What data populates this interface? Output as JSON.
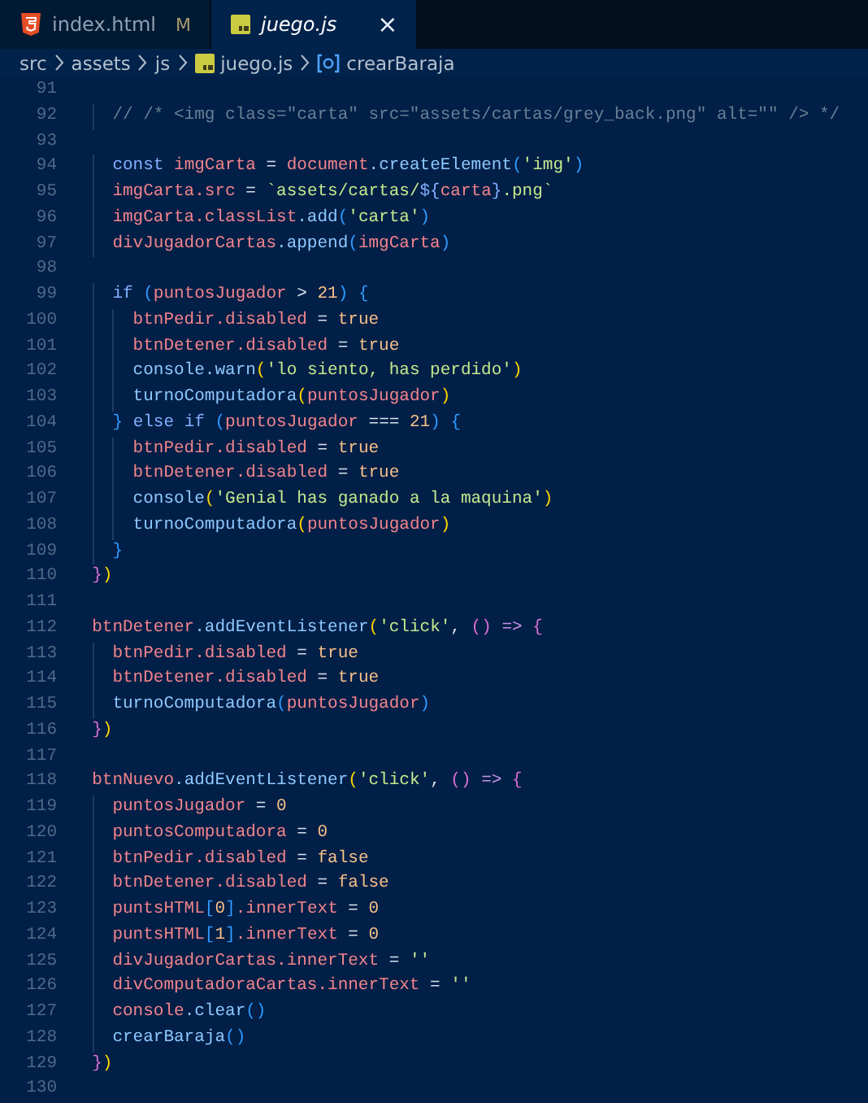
{
  "tabs": [
    {
      "kind": "html",
      "label": "index.html",
      "status": "M",
      "selected": false,
      "preview": false
    },
    {
      "kind": "js",
      "label": "juego.js",
      "close": "×",
      "selected": true,
      "preview": true
    }
  ],
  "breadcrumb": [
    {
      "kind": "folder",
      "label": "src"
    },
    {
      "kind": "folder",
      "label": "assets"
    },
    {
      "kind": "folder",
      "label": "js"
    },
    {
      "kind": "js",
      "label": "juego.js"
    },
    {
      "kind": "symbol",
      "label": "crearBaraja"
    }
  ],
  "lines": [
    {
      "number": "91"
    },
    {
      "number": "92",
      "tokens": [
        {
          "kind": "comment",
          "text": "    // /* <img class=\"carta\" src=\"assets/cartas/grey_back.png\" alt=\"\" /> */"
        }
      ]
    },
    {
      "number": "93"
    },
    {
      "number": "94",
      "tokens": [
        {
          "kind": "keyword",
          "text": "    const "
        },
        {
          "kind": "variable",
          "text": "imgCarta"
        },
        {
          "kind": "plain",
          "text": " = "
        },
        {
          "kind": "variable",
          "text": "document"
        },
        {
          "kind": "function",
          "text": ".createElement"
        },
        {
          "kind": "bracket3",
          "text": "("
        },
        {
          "kind": "string",
          "text": "'img'"
        },
        {
          "kind": "bracket3",
          "text": ")"
        }
      ]
    },
    {
      "number": "95",
      "tokens": [
        {
          "kind": "variable",
          "text": "    imgCarta.src"
        },
        {
          "kind": "plain",
          "text": " = "
        },
        {
          "kind": "string",
          "text": "`assets/cartas/"
        },
        {
          "kind": "keyword",
          "text": "${"
        },
        {
          "kind": "variable",
          "text": "carta"
        },
        {
          "kind": "keyword",
          "text": "}"
        },
        {
          "kind": "string",
          "text": ".png`"
        }
      ]
    },
    {
      "number": "96",
      "tokens": [
        {
          "kind": "variable",
          "text": "    imgCarta.classList"
        },
        {
          "kind": "function",
          "text": ".add"
        },
        {
          "kind": "bracket3",
          "text": "("
        },
        {
          "kind": "string",
          "text": "'carta'"
        },
        {
          "kind": "bracket3",
          "text": ")"
        }
      ]
    },
    {
      "number": "97",
      "tokens": [
        {
          "kind": "variable",
          "text": "    divJugadorCartas"
        },
        {
          "kind": "function",
          "text": ".append"
        },
        {
          "kind": "bracket3",
          "text": "("
        },
        {
          "kind": "variable",
          "text": "imgCarta"
        },
        {
          "kind": "bracket3",
          "text": ")"
        }
      ]
    },
    {
      "number": "98"
    },
    {
      "number": "99",
      "tokens": [
        {
          "kind": "keyword",
          "text": "    if "
        },
        {
          "kind": "bracket3",
          "text": "("
        },
        {
          "kind": "variable",
          "text": "puntosJugador"
        },
        {
          "kind": "plain",
          "text": " > "
        },
        {
          "kind": "number",
          "text": "21"
        },
        {
          "kind": "bracket3",
          "text": ") {"
        }
      ]
    },
    {
      "number": "100",
      "tokens": [
        {
          "kind": "variable",
          "text": "      btnPedir.disabled"
        },
        {
          "kind": "plain",
          "text": " = "
        },
        {
          "kind": "boolean",
          "text": "true"
        }
      ]
    },
    {
      "number": "101",
      "tokens": [
        {
          "kind": "variable",
          "text": "      btnDetener.disabled"
        },
        {
          "kind": "plain",
          "text": " = "
        },
        {
          "kind": "boolean",
          "text": "true"
        }
      ]
    },
    {
      "number": "102",
      "tokens": [
        {
          "kind": "function",
          "text": "      console.warn"
        },
        {
          "kind": "bracket1",
          "text": "("
        },
        {
          "kind": "string",
          "text": "'lo siento, has perdido'"
        },
        {
          "kind": "bracket1",
          "text": ")"
        }
      ]
    },
    {
      "number": "103",
      "tokens": [
        {
          "kind": "function",
          "text": "      turnoComputadora"
        },
        {
          "kind": "bracket1",
          "text": "("
        },
        {
          "kind": "variable",
          "text": "puntosJugador"
        },
        {
          "kind": "bracket1",
          "text": ")"
        }
      ]
    },
    {
      "number": "104",
      "tokens": [
        {
          "kind": "bracket3",
          "text": "    }"
        },
        {
          "kind": "keyword",
          "text": " else if "
        },
        {
          "kind": "bracket3",
          "text": "("
        },
        {
          "kind": "variable",
          "text": "puntosJugador"
        },
        {
          "kind": "plain",
          "text": " === "
        },
        {
          "kind": "number",
          "text": "21"
        },
        {
          "kind": "bracket3",
          "text": ") {"
        }
      ]
    },
    {
      "number": "105",
      "tokens": [
        {
          "kind": "variable",
          "text": "      btnPedir.disabled"
        },
        {
          "kind": "plain",
          "text": " = "
        },
        {
          "kind": "boolean",
          "text": "true"
        }
      ]
    },
    {
      "number": "106",
      "tokens": [
        {
          "kind": "variable",
          "text": "      btnDetener.disabled"
        },
        {
          "kind": "plain",
          "text": " = "
        },
        {
          "kind": "boolean",
          "text": "true"
        }
      ]
    },
    {
      "number": "107",
      "tokens": [
        {
          "kind": "function",
          "text": "      console"
        },
        {
          "kind": "bracket1",
          "text": "("
        },
        {
          "kind": "string",
          "text": "'Genial has ganado a la maquina'"
        },
        {
          "kind": "bracket1",
          "text": ")"
        }
      ]
    },
    {
      "number": "108",
      "tokens": [
        {
          "kind": "function",
          "text": "      turnoComputadora"
        },
        {
          "kind": "bracket1",
          "text": "("
        },
        {
          "kind": "variable",
          "text": "puntosJugador"
        },
        {
          "kind": "bracket1",
          "text": ")"
        }
      ]
    },
    {
      "number": "109",
      "tokens": [
        {
          "kind": "bracket3",
          "text": "    }"
        }
      ]
    },
    {
      "number": "110",
      "tokens": [
        {
          "kind": "bracket2",
          "text": "  }"
        },
        {
          "kind": "bracket1",
          "text": ")"
        }
      ]
    },
    {
      "number": "111"
    },
    {
      "number": "112",
      "tokens": [
        {
          "kind": "variable",
          "text": "  btnDetener"
        },
        {
          "kind": "function",
          "text": ".addEventListener"
        },
        {
          "kind": "bracket1",
          "text": "("
        },
        {
          "kind": "string",
          "text": "'click'"
        },
        {
          "kind": "plain",
          "text": ", "
        },
        {
          "kind": "bracket2",
          "text": "()"
        },
        {
          "kind": "arrow",
          "text": " => "
        },
        {
          "kind": "bracket2",
          "text": "{"
        }
      ]
    },
    {
      "number": "113",
      "tokens": [
        {
          "kind": "variable",
          "text": "    btnPedir.disabled"
        },
        {
          "kind": "plain",
          "text": " = "
        },
        {
          "kind": "boolean",
          "text": "true"
        }
      ]
    },
    {
      "number": "114",
      "tokens": [
        {
          "kind": "variable",
          "text": "    btnDetener.disabled"
        },
        {
          "kind": "plain",
          "text": " = "
        },
        {
          "kind": "boolean",
          "text": "true"
        }
      ]
    },
    {
      "number": "115",
      "tokens": [
        {
          "kind": "function",
          "text": "    turnoComputadora"
        },
        {
          "kind": "bracket3",
          "text": "("
        },
        {
          "kind": "variable",
          "text": "puntosJugador"
        },
        {
          "kind": "bracket3",
          "text": ")"
        }
      ]
    },
    {
      "number": "116",
      "tokens": [
        {
          "kind": "bracket2",
          "text": "  }"
        },
        {
          "kind": "bracket1",
          "text": ")"
        }
      ]
    },
    {
      "number": "117"
    },
    {
      "number": "118",
      "tokens": [
        {
          "kind": "variable",
          "text": "  btnNuevo"
        },
        {
          "kind": "function",
          "text": ".addEventListener"
        },
        {
          "kind": "bracket1",
          "text": "("
        },
        {
          "kind": "string",
          "text": "'click'"
        },
        {
          "kind": "plain",
          "text": ", "
        },
        {
          "kind": "bracket2",
          "text": "()"
        },
        {
          "kind": "arrow",
          "text": " => "
        },
        {
          "kind": "bracket2",
          "text": "{"
        }
      ]
    },
    {
      "number": "119",
      "tokens": [
        {
          "kind": "variable",
          "text": "    puntosJugador"
        },
        {
          "kind": "plain",
          "text": " = "
        },
        {
          "kind": "number",
          "text": "0"
        }
      ]
    },
    {
      "number": "120",
      "tokens": [
        {
          "kind": "variable",
          "text": "    puntosComputadora"
        },
        {
          "kind": "plain",
          "text": " = "
        },
        {
          "kind": "number",
          "text": "0"
        }
      ]
    },
    {
      "number": "121",
      "tokens": [
        {
          "kind": "variable",
          "text": "    btnPedir.disabled"
        },
        {
          "kind": "plain",
          "text": " = "
        },
        {
          "kind": "boolean",
          "text": "false"
        }
      ]
    },
    {
      "number": "122",
      "tokens": [
        {
          "kind": "variable",
          "text": "    btnDetener.disabled"
        },
        {
          "kind": "plain",
          "text": " = "
        },
        {
          "kind": "boolean",
          "text": "false"
        }
      ]
    },
    {
      "number": "123",
      "tokens": [
        {
          "kind": "variable",
          "text": "    puntsHTML"
        },
        {
          "kind": "bracket3",
          "text": "["
        },
        {
          "kind": "number",
          "text": "0"
        },
        {
          "kind": "bracket3",
          "text": "]"
        },
        {
          "kind": "variable",
          "text": ".innerText"
        },
        {
          "kind": "plain",
          "text": " = "
        },
        {
          "kind": "number",
          "text": "0"
        }
      ]
    },
    {
      "number": "124",
      "tokens": [
        {
          "kind": "variable",
          "text": "    puntsHTML"
        },
        {
          "kind": "bracket3",
          "text": "["
        },
        {
          "kind": "number",
          "text": "1"
        },
        {
          "kind": "bracket3",
          "text": "]"
        },
        {
          "kind": "variable",
          "text": ".innerText"
        },
        {
          "kind": "plain",
          "text": " = "
        },
        {
          "kind": "number",
          "text": "0"
        }
      ]
    },
    {
      "number": "125",
      "tokens": [
        {
          "kind": "variable",
          "text": "    divJugadorCartas.innerText"
        },
        {
          "kind": "plain",
          "text": " = "
        },
        {
          "kind": "string",
          "text": "''"
        }
      ]
    },
    {
      "number": "126",
      "tokens": [
        {
          "kind": "variable",
          "text": "    divComputadoraCartas.innerText"
        },
        {
          "kind": "plain",
          "text": " = "
        },
        {
          "kind": "string",
          "text": "''"
        }
      ]
    },
    {
      "number": "127",
      "tokens": [
        {
          "kind": "variable",
          "text": "    console"
        },
        {
          "kind": "function",
          "text": ".clear"
        },
        {
          "kind": "bracket3",
          "text": "()"
        }
      ]
    },
    {
      "number": "128",
      "tokens": [
        {
          "kind": "function",
          "text": "    crearBaraja"
        },
        {
          "kind": "bracket3",
          "text": "()"
        }
      ]
    },
    {
      "number": "129",
      "tokens": [
        {
          "kind": "bracket2",
          "text": "  }"
        },
        {
          "kind": "bracket1",
          "text": ")"
        }
      ]
    },
    {
      "number": "130"
    }
  ]
}
